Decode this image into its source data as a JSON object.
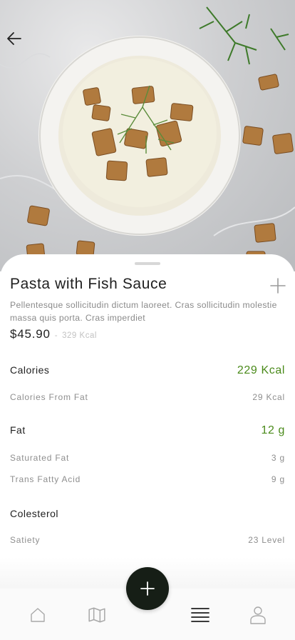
{
  "nav_top": {
    "back_icon": "arrow-left-icon"
  },
  "dish": {
    "title": "Pasta with Fish Sauce",
    "description": "Pellentesque sollicitudin dictum laoreet. Cras sollicitudin molestie massa quis porta. Cras imperdiet",
    "price": "$45.90",
    "price_separator": "-",
    "kcal": "329 Kcal",
    "add_icon": "plus-icon"
  },
  "nutrition": {
    "calories": {
      "label": "Calories",
      "value": "229 Kcal"
    },
    "calories_from_fat": {
      "label": "Calories From Fat",
      "value": "29 Kcal"
    },
    "fat": {
      "label": "Fat",
      "value": "12 g"
    },
    "saturated_fat": {
      "label": "Saturated Fat",
      "value": "3 g"
    },
    "trans_fatty_acid": {
      "label": "Trans Fatty Acid",
      "value": "9 g"
    },
    "colesterol": {
      "label": "Colesterol"
    },
    "satiety": {
      "label": "Satiety",
      "value": "23 Level"
    }
  },
  "bottom_nav": {
    "items": [
      "home-icon",
      "map-icon",
      "list-icon",
      "profile-icon"
    ],
    "fab_icon": "plus-icon"
  },
  "colors": {
    "accent_green": "#4a8a1a",
    "fab_background": "#161e16"
  }
}
